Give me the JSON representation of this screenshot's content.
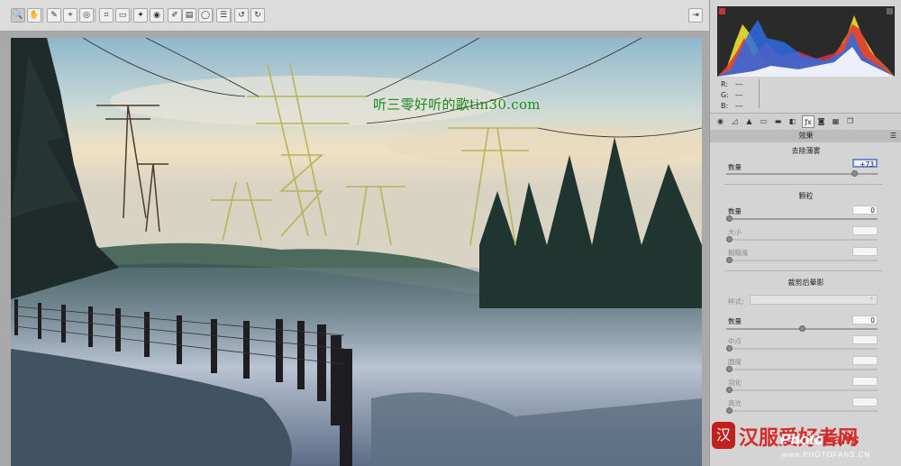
{
  "toolbar": {
    "tools": [
      {
        "name": "zoom-tool",
        "glyph": "🔍"
      },
      {
        "name": "hand-tool",
        "glyph": "✋"
      },
      {
        "name": "white-balance-tool",
        "glyph": "✎"
      },
      {
        "name": "color-sampler-tool",
        "glyph": "⌖"
      },
      {
        "name": "targeted-adjustment-tool",
        "glyph": "◎"
      },
      {
        "name": "crop-tool",
        "glyph": "⌗"
      },
      {
        "name": "straighten-tool",
        "glyph": "▭"
      },
      {
        "name": "spot-removal-tool",
        "glyph": "✦"
      },
      {
        "name": "red-eye-tool",
        "glyph": "◉"
      },
      {
        "name": "adjustment-brush-tool",
        "glyph": "✐"
      },
      {
        "name": "graduated-filter-tool",
        "glyph": "▤"
      },
      {
        "name": "radial-filter-tool",
        "glyph": "◯"
      },
      {
        "name": "preferences-tool",
        "glyph": "☰"
      },
      {
        "name": "rotate-left-tool",
        "glyph": "↺"
      },
      {
        "name": "rotate-right-tool",
        "glyph": "↻"
      }
    ],
    "fullscreen_glyph": "⇥"
  },
  "histogram": {
    "r_label": "R:",
    "r_value": "---",
    "g_label": "G:",
    "g_value": "---",
    "b_label": "B:",
    "b_value": "---"
  },
  "panel_tabs": [
    "◉",
    "◿",
    "▲",
    "▭",
    "▬",
    "◧",
    "ƒx",
    "◙",
    "▦",
    "❐"
  ],
  "effects": {
    "header": "效果",
    "dehaze": {
      "title": "去除薄雾",
      "amount_label": "数量",
      "amount_value": "+73",
      "amount_level": 0.865
    },
    "grain": {
      "title": "颗粒",
      "amount_label": "数量",
      "amount_value": "0",
      "amount_level": 0,
      "size_label": "大小",
      "size_level": 0,
      "roughness_label": "粗糙度",
      "roughness_level": 0
    },
    "vignette": {
      "title": "裁剪后晕影",
      "style_label": "样式:",
      "style_value": "",
      "amount_label": "数量",
      "amount_value": "0",
      "amount_level": 0.5,
      "midpoint_label": "中点",
      "midpoint_level": 0,
      "roundness_label": "圆度",
      "roundness_level": 0,
      "feather_label": "羽化",
      "feather_level": 0,
      "highlights_label": "高光",
      "highlights_level": 0
    }
  },
  "watermark": "听三零好听的歌tin30.com",
  "brand": {
    "seal": "汉",
    "cn": "汉服爱好者网",
    "en_a": "Photo",
    "en_b": "Fans",
    "url": "www.PHOTOFANS.CN"
  },
  "colors": {
    "accent": "#6a8ed6",
    "panel_bg": "#d4d4d4",
    "stage_bg": "#a9a9a9"
  }
}
